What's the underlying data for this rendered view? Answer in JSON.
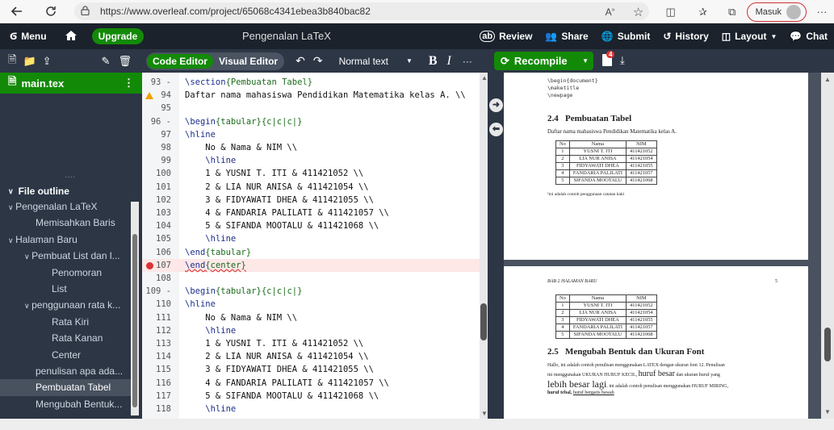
{
  "browser": {
    "url": "https://www.overleaf.com/project/65068c4341ebea3b840bac82",
    "signin_label": "Masuk",
    "more": "···"
  },
  "topbar": {
    "menu": "Menu",
    "upgrade": "Upgrade",
    "project_title": "Pengenalan LaTeX",
    "review": "Review",
    "share": "Share",
    "submit": "Submit",
    "history": "History",
    "layout": "Layout",
    "chat": "Chat"
  },
  "toolbar": {
    "code_editor": "Code Editor",
    "visual_editor": "Visual Editor",
    "text_style": "Normal text",
    "bold": "B",
    "italic": "I",
    "more": "···",
    "recompile": "Recompile",
    "log_badge": "4"
  },
  "files": {
    "main": "main.tex"
  },
  "outline": {
    "header": "File outline",
    "items": [
      {
        "label": "Pengenalan LaTeX",
        "indent": 0,
        "expanded": true,
        "selected": false
      },
      {
        "label": "Memisahkan Baris",
        "indent": 1,
        "expanded": null,
        "selected": false
      },
      {
        "label": "Halaman Baru",
        "indent": 0,
        "expanded": true,
        "selected": false
      },
      {
        "label": "Pembuat List dan l...",
        "indent": 1,
        "expanded": true,
        "selected": false
      },
      {
        "label": "Penomoran",
        "indent": 2,
        "expanded": null,
        "selected": false
      },
      {
        "label": "List",
        "indent": 2,
        "expanded": null,
        "selected": false
      },
      {
        "label": "penggunaan rata k...",
        "indent": 1,
        "expanded": true,
        "selected": false
      },
      {
        "label": "Rata Kiri",
        "indent": 2,
        "expanded": null,
        "selected": false
      },
      {
        "label": "Rata Kanan",
        "indent": 2,
        "expanded": null,
        "selected": false
      },
      {
        "label": "Center",
        "indent": 2,
        "expanded": null,
        "selected": false
      },
      {
        "label": "penulisan apa ada...",
        "indent": 1,
        "expanded": null,
        "selected": false
      },
      {
        "label": "Pembuatan Tabel",
        "indent": 1,
        "expanded": null,
        "selected": true
      },
      {
        "label": "Mengubah Bentuk...",
        "indent": 1,
        "expanded": null,
        "selected": false
      }
    ]
  },
  "editor": {
    "lines": [
      {
        "n": "93",
        "fold": "-",
        "text": "\\section{Pembuatan Tabel}",
        "marker": ""
      },
      {
        "n": "94",
        "fold": "",
        "text": "Daftar nama mahasiswa Pendidikan Matematika kelas A. \\\\",
        "marker": "warning"
      },
      {
        "n": "95",
        "fold": "",
        "text": "",
        "marker": ""
      },
      {
        "n": "96",
        "fold": "-",
        "text": "\\begin{tabular}{c|c|c|}",
        "marker": ""
      },
      {
        "n": "97",
        "fold": "",
        "text": "\\hline",
        "marker": ""
      },
      {
        "n": "98",
        "fold": "",
        "text": "    No & Nama & NIM \\\\",
        "marker": ""
      },
      {
        "n": "99",
        "fold": "",
        "text": "    \\hline",
        "marker": ""
      },
      {
        "n": "100",
        "fold": "",
        "text": "    1 & YUSNI T. ITI & 411421052 \\\\",
        "marker": ""
      },
      {
        "n": "101",
        "fold": "",
        "text": "    2 & LIA NUR ANISA & 411421054 \\\\",
        "marker": ""
      },
      {
        "n": "102",
        "fold": "",
        "text": "    3 & FIDYAWATI DHEA & 411421055 \\\\",
        "marker": ""
      },
      {
        "n": "103",
        "fold": "",
        "text": "    4 & FANDARIA PALILATI & 411421057 \\\\",
        "marker": ""
      },
      {
        "n": "104",
        "fold": "",
        "text": "    5 & SIFANDA MOOTALU & 411421068 \\\\",
        "marker": ""
      },
      {
        "n": "105",
        "fold": "",
        "text": "    \\hline",
        "marker": ""
      },
      {
        "n": "106",
        "fold": "",
        "text": "\\end{tabular}",
        "marker": ""
      },
      {
        "n": "107",
        "fold": "",
        "text": "\\end{center}",
        "marker": "error"
      },
      {
        "n": "108",
        "fold": "",
        "text": "",
        "marker": ""
      },
      {
        "n": "109",
        "fold": "-",
        "text": "\\begin{tabular}{c|c|c|}",
        "marker": ""
      },
      {
        "n": "110",
        "fold": "",
        "text": "\\hline",
        "marker": ""
      },
      {
        "n": "111",
        "fold": "",
        "text": "    No & Nama & NIM \\\\",
        "marker": ""
      },
      {
        "n": "112",
        "fold": "",
        "text": "    \\hline",
        "marker": ""
      },
      {
        "n": "113",
        "fold": "",
        "text": "    1 & YUSNI T. ITI & 411421052 \\\\",
        "marker": ""
      },
      {
        "n": "114",
        "fold": "",
        "text": "    2 & LIA NUR ANISA & 411421054 \\\\",
        "marker": ""
      },
      {
        "n": "115",
        "fold": "",
        "text": "    3 & FIDYAWATI DHEA & 411421055 \\\\",
        "marker": ""
      },
      {
        "n": "116",
        "fold": "",
        "text": "    4 & FANDARIA PALILATI & 411421057 \\\\",
        "marker": ""
      },
      {
        "n": "117",
        "fold": "",
        "text": "    5 & SIFANDA MOOTALU & 411421068 \\\\",
        "marker": ""
      },
      {
        "n": "118",
        "fold": "",
        "text": "    \\hline",
        "marker": ""
      }
    ]
  },
  "pdf": {
    "page1": {
      "verbatim": [
        "\\begin{document}",
        "\\maketitle",
        "\\newpage"
      ],
      "section_num": "2.4",
      "section_title": "Pembuatan Tabel",
      "intro": "Daftar nama mahasiswa Pendidikan Matematika kelas A.",
      "table": [
        [
          "No",
          "Nama",
          "NIM"
        ],
        [
          "1",
          "YUSNI T. ITI",
          "411421052"
        ],
        [
          "2",
          "LIA NUR ANISA",
          "411421054"
        ],
        [
          "3",
          "FIDYAWATI DHEA",
          "411421055"
        ],
        [
          "4",
          "FANDARIA PALILATI",
          "411421057"
        ],
        [
          "5",
          "SIFANDA MOOTALU",
          "411421068"
        ]
      ],
      "footnote": "¹ini adalah contoh penggunaan catatan kaki"
    },
    "page2": {
      "header_left": "BAB 2   HALAMAN BARU",
      "header_right": "5",
      "table": [
        [
          "No",
          "Nama",
          "NIM"
        ],
        [
          "1",
          "YUSNI T. ITI",
          "411421052"
        ],
        [
          "2",
          "LIA NUR ANISA",
          "411421054"
        ],
        [
          "3",
          "FIDYAWATI DHEA",
          "411421055"
        ],
        [
          "4",
          "FANDARIA PALILATI",
          "411421057"
        ],
        [
          "5",
          "SIFANDA MOOTALU",
          "411421068"
        ]
      ],
      "section_num": "2.5",
      "section_title": "Mengubah Bentuk dan Ukuran Font",
      "p1": "Hallo, ini adalah contoh penulisan menggunakan LATEX dengan ukuran font 12. Penulisan",
      "p2a": "ini menggunakan UKURAN HURUF KECIL,",
      "p2b": "huruf besar",
      "p2c": "dan ukuran huruf yang",
      "p3a": "lebih besar lagi",
      "p3b": ". ini adalah contoh penulisan menggunakan HURUF MIRING,",
      "p4a": "huruf tebal,",
      "p4b": "huruf bergaris bawah"
    }
  }
}
